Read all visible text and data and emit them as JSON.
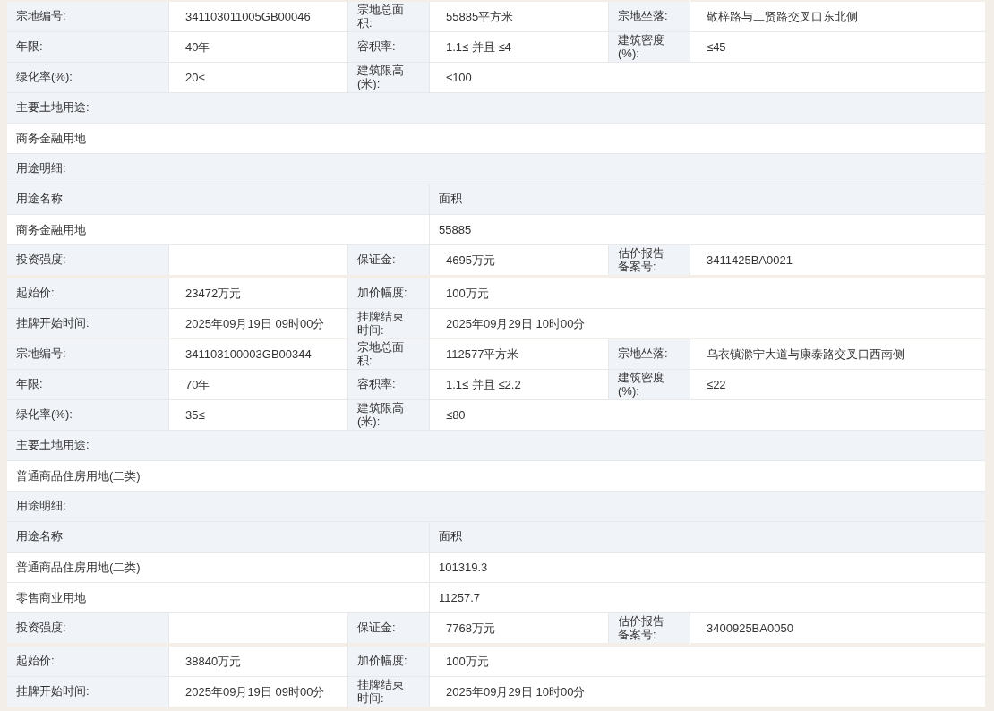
{
  "parcels": [
    {
      "info_rows": [
        [
          {
            "label": "宗地编号:",
            "value": "341103011005GB00046"
          },
          {
            "label": "宗地总面积:",
            "value": "55885平方米"
          },
          {
            "label": "宗地坐落:",
            "value": "敬梓路与二贤路交叉口东北侧"
          }
        ],
        [
          {
            "label": "年限:",
            "value": "40年"
          },
          {
            "label": "容积率:",
            "value": "1.1≤ 并且 ≤4"
          },
          {
            "label": "建筑密度(%):",
            "value": "≤45"
          }
        ],
        [
          {
            "label": "绿化率(%):",
            "value": "20≤"
          },
          {
            "label": "建筑限高(米):",
            "value": "≤100"
          }
        ]
      ],
      "main_use": {
        "label": "主要土地用途:",
        "value": "商务金融用地"
      },
      "use_detail": {
        "label": "用途明细:",
        "columns": [
          "用途名称",
          "面积"
        ],
        "rows": [
          [
            "商务金融用地",
            "55885"
          ]
        ]
      },
      "fee_row": [
        {
          "label": "投资强度:"
        },
        {
          "label": "保证金:",
          "value": "4695万元"
        },
        {
          "label": "估价报告备案号:",
          "value": "3411425BA0021"
        }
      ],
      "price_rows": [
        [
          {
            "label": "起始价:",
            "value": "23472万元"
          },
          {
            "label": "加价幅度:",
            "value": "100万元"
          }
        ],
        [
          {
            "label": "挂牌开始时间:",
            "value": "2025年09月19日 09时00分"
          },
          {
            "label": "挂牌结束时间:",
            "value": "2025年09月29日 10时00分"
          }
        ]
      ]
    },
    {
      "info_rows": [
        [
          {
            "label": "宗地编号:",
            "value": "341103100003GB00344"
          },
          {
            "label": "宗地总面积:",
            "value": "112577平方米"
          },
          {
            "label": "宗地坐落:",
            "value": "乌衣镇滁宁大道与康泰路交叉口西南侧"
          }
        ],
        [
          {
            "label": "年限:",
            "value": "70年"
          },
          {
            "label": "容积率:",
            "value": "1.1≤ 并且 ≤2.2"
          },
          {
            "label": "建筑密度(%):",
            "value": "≤22"
          }
        ],
        [
          {
            "label": "绿化率(%):",
            "value": "35≤"
          },
          {
            "label": "建筑限高(米):",
            "value": "≤80"
          }
        ]
      ],
      "main_use": {
        "label": "主要土地用途:",
        "value": "普通商品住房用地(二类)"
      },
      "use_detail": {
        "label": "用途明细:",
        "columns": [
          "用途名称",
          "面积"
        ],
        "rows": [
          [
            "普通商品住房用地(二类)",
            "101319.3"
          ],
          [
            "零售商业用地",
            "11257.7"
          ]
        ]
      },
      "fee_row": [
        {
          "label": "投资强度:"
        },
        {
          "label": "保证金:",
          "value": "7768万元"
        },
        {
          "label": "估价报告备案号:",
          "value": "3400925BA0050"
        }
      ],
      "price_rows": [
        [
          {
            "label": "起始价:",
            "value": "38840万元"
          },
          {
            "label": "加价幅度:",
            "value": "100万元"
          }
        ],
        [
          {
            "label": "挂牌开始时间:",
            "value": "2025年09月19日 09时00分"
          },
          {
            "label": "挂牌结束时间:",
            "value": "2025年09月29日 10时00分"
          }
        ]
      ]
    }
  ]
}
